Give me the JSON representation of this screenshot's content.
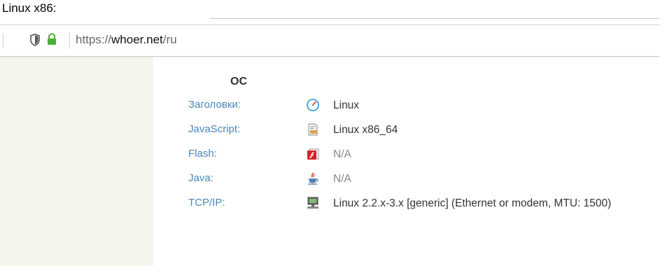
{
  "caption": "Linux x86:",
  "browser": {
    "url_scheme": "https://",
    "url_host": "whoer.net",
    "url_path": "/ru"
  },
  "section": {
    "title": "ОС"
  },
  "rows": [
    {
      "label": "Заголовки:",
      "icon": "clock-compass-icon",
      "value": "Linux"
    },
    {
      "label": "JavaScript:",
      "icon": "script-document-icon",
      "value": "Linux x86_64"
    },
    {
      "label": "Flash:",
      "icon": "flash-player-icon",
      "value": "N/A"
    },
    {
      "label": "Java:",
      "icon": "java-cup-icon",
      "value": "N/A"
    },
    {
      "label": "TCP/IP:",
      "icon": "network-computer-icon",
      "value": "Linux 2.2.x-3.x [generic] (Ethernet or modem, MTU: 1500)"
    }
  ],
  "colors": {
    "label": "#4a86b8",
    "sidebar": "#f4f6eb",
    "lock": "#4caf3a"
  }
}
